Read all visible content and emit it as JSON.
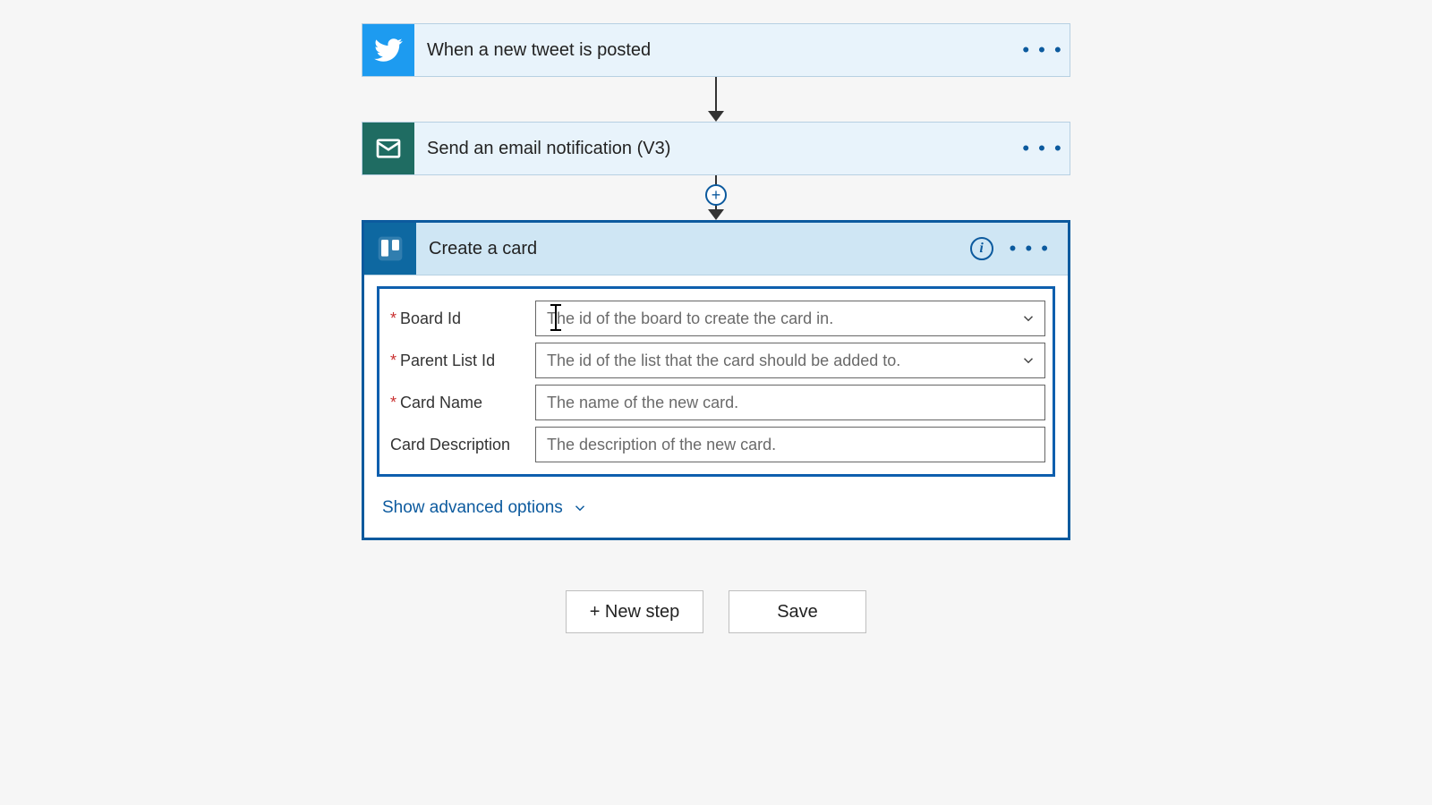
{
  "steps": {
    "twitter": {
      "title": "When a new tweet is posted"
    },
    "email": {
      "title": "Send an email notification (V3)"
    },
    "trello": {
      "title": "Create a card"
    }
  },
  "fields": {
    "board_id": {
      "label": "Board Id",
      "placeholder": "The id of the board to create the card in.",
      "required": true,
      "dropdown": true
    },
    "parent_list_id": {
      "label": "Parent List Id",
      "placeholder": "The id of the list that the card should be added to.",
      "required": true,
      "dropdown": true
    },
    "card_name": {
      "label": "Card Name",
      "placeholder": "The name of the new card.",
      "required": true,
      "dropdown": false
    },
    "card_description": {
      "label": "Card Description",
      "placeholder": "The description of the new card.",
      "required": false,
      "dropdown": false
    }
  },
  "advanced_label": "Show advanced options",
  "buttons": {
    "new_step": "+ New step",
    "save": "Save"
  },
  "menu_dots": "• • •",
  "info_glyph": "i",
  "required_mark": "*"
}
